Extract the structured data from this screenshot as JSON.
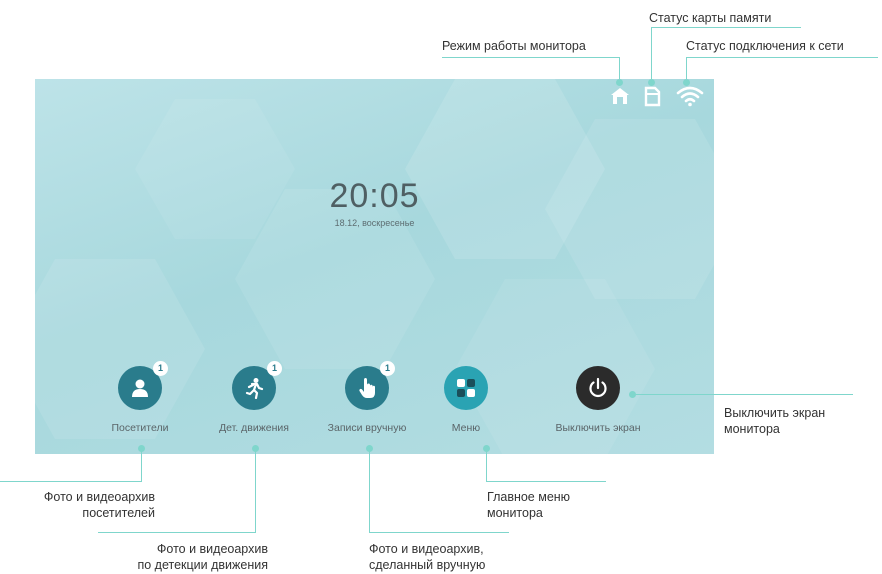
{
  "annotations": {
    "memory_card_status": "Статус карты памяти",
    "monitor_mode": "Режим работы монитора",
    "network_status": "Статус подключения к сети",
    "screen_off_line1": "Выключить экран",
    "screen_off_line2": "монитора",
    "visitors_line1": "Фото и видеоархив",
    "visitors_line2": "посетителей",
    "motion_line1": "Фото и видеоархив",
    "motion_line2": "по детекции движения",
    "main_menu_line1": "Главное меню",
    "main_menu_line2": "монитора",
    "manual_line1": "Фото и видеоархив,",
    "manual_line2": "сделанный вручную"
  },
  "screen": {
    "time": "20:05",
    "date": "18.12, воскресенье",
    "status_icons": [
      "home-mode-icon",
      "sd-card-icon",
      "wifi-icon"
    ],
    "buttons": [
      {
        "label": "Посетители",
        "icon": "person-icon",
        "badge": "1",
        "color": "#2a7c8c"
      },
      {
        "label": "Дет. движения",
        "icon": "running-man-icon",
        "badge": "1",
        "color": "#2a7c8c"
      },
      {
        "label": "Записи вручную",
        "icon": "hand-tap-icon",
        "badge": "1",
        "color": "#2a7c8c"
      },
      {
        "label": "Меню",
        "icon": "menu-grid-icon",
        "badge": "",
        "color": "#2aa3b3"
      },
      {
        "label": "Выключить экран",
        "icon": "power-icon",
        "badge": "",
        "color": "#2b2b2b"
      }
    ]
  },
  "colors": {
    "leader": "#7fd6cc",
    "screen_bg": "#a9d9de",
    "badge_text": "#2a7c8c"
  }
}
